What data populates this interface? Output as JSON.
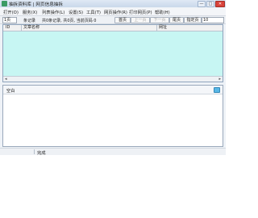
{
  "window": {
    "title": "抽拆资料库 | 网页信息抽拆",
    "controls": {
      "minimize": "—",
      "maximize": "□",
      "close": "✕"
    }
  },
  "menu": {
    "items": [
      "打开(O)",
      "服务(X)",
      "列表操作(L)",
      "设置(S)",
      "工具(T)",
      "网页操作(R)",
      "打印网页(P)",
      "帮助(H)"
    ]
  },
  "toolbar": {
    "page_size_value": "1页",
    "total_label": "条记录",
    "summary": "共0条记录, 共0页, 当前页码 0",
    "first_page": "首页",
    "prev_page": "上一页",
    "next_page": "下一页",
    "last_page": "尾页",
    "goto_page": "指定页",
    "goto_value": "10"
  },
  "grid": {
    "columns": [
      "ID",
      "文章名称",
      "网址"
    ]
  },
  "lower": {
    "blank_label": "空白"
  },
  "status": {
    "text": "完成"
  },
  "colors": {
    "grid_background": "#c7f6f3",
    "window_background": "#eef2f7",
    "close_button": "#d9423a"
  },
  "icons": [
    "app-icon",
    "panel-icon"
  ]
}
